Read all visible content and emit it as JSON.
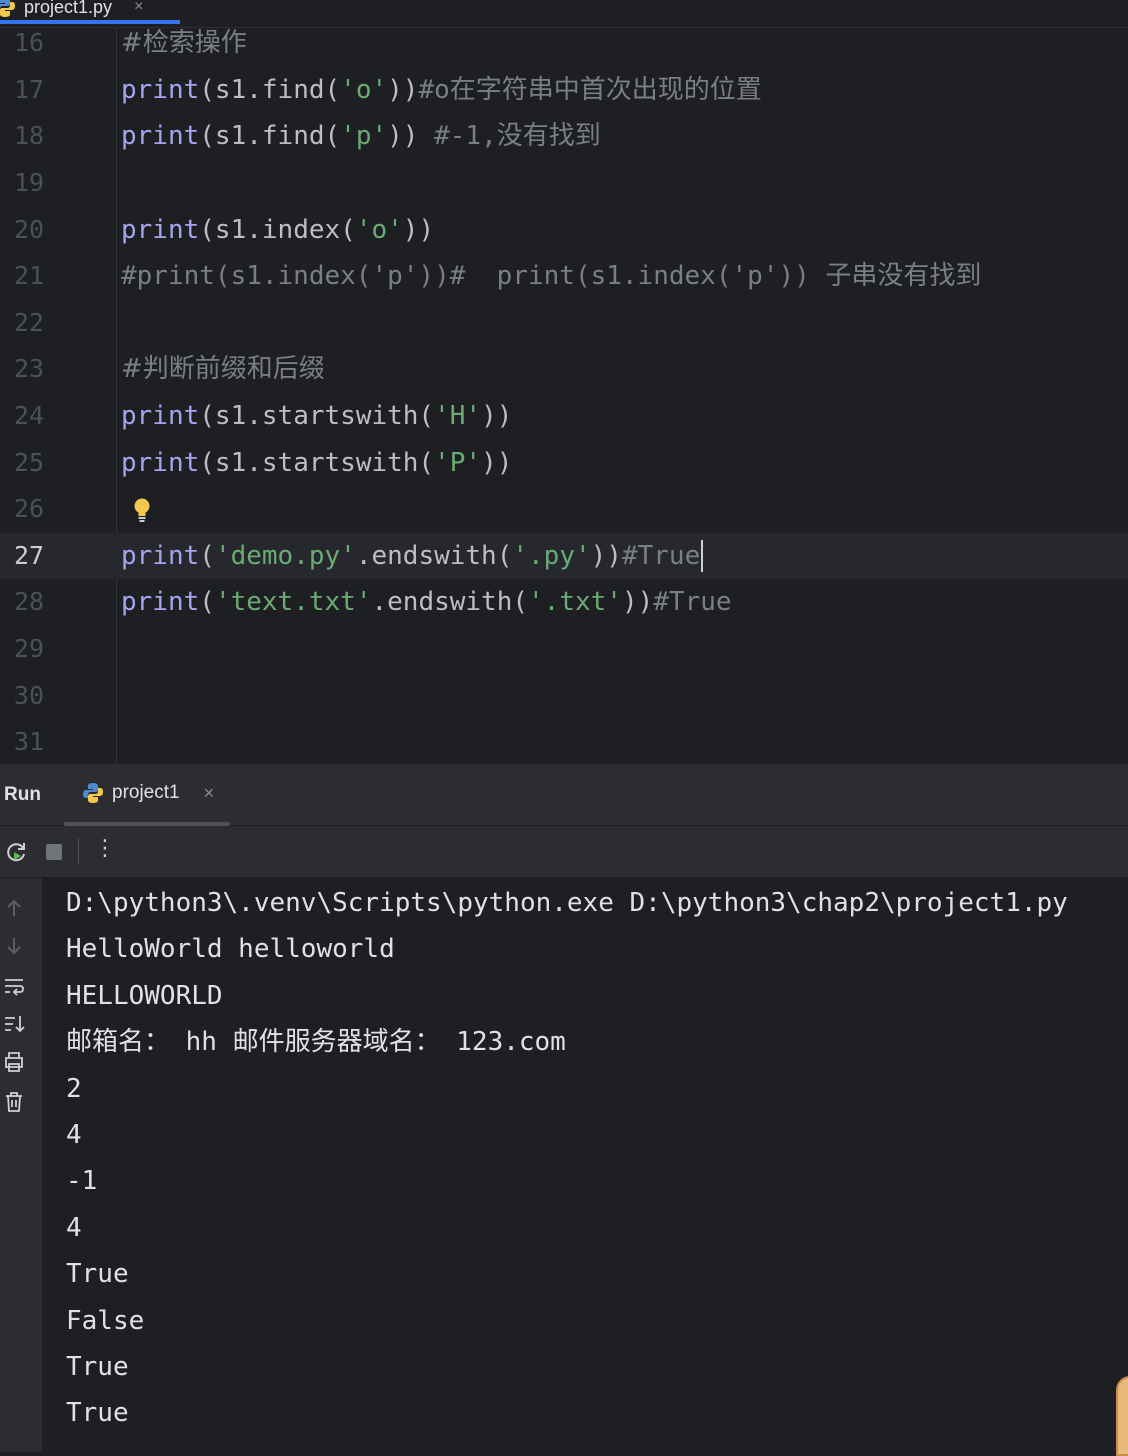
{
  "editor_tab": {
    "filename": "project1.py",
    "close": "×"
  },
  "code_lines": [
    {
      "num": "16",
      "parts": [
        {
          "t": "#检索操作",
          "c": "cmt cjk"
        }
      ]
    },
    {
      "num": "17",
      "parts": [
        {
          "t": "print",
          "c": "kw"
        },
        {
          "t": "(s1.find(",
          "c": "plain"
        },
        {
          "t": "'o'",
          "c": "str"
        },
        {
          "t": "))",
          "c": "plain"
        },
        {
          "t": "#o在字符串中首次出现的位置",
          "c": "cmt"
        }
      ]
    },
    {
      "num": "18",
      "parts": [
        {
          "t": "print",
          "c": "kw"
        },
        {
          "t": "(s1.find(",
          "c": "plain"
        },
        {
          "t": "'p'",
          "c": "str"
        },
        {
          "t": ")) ",
          "c": "plain"
        },
        {
          "t": "#-1,没有找到",
          "c": "cmt"
        }
      ]
    },
    {
      "num": "19",
      "parts": []
    },
    {
      "num": "20",
      "parts": [
        {
          "t": "print",
          "c": "kw"
        },
        {
          "t": "(s1.index(",
          "c": "plain"
        },
        {
          "t": "'o'",
          "c": "str"
        },
        {
          "t": "))",
          "c": "plain"
        }
      ]
    },
    {
      "num": "21",
      "parts": [
        {
          "t": "#print(s1.index('p'))#  print(s1.index('p')) 子串没有找到",
          "c": "cmt"
        }
      ]
    },
    {
      "num": "22",
      "parts": []
    },
    {
      "num": "23",
      "parts": [
        {
          "t": "#判断前缀和后缀",
          "c": "cmt cjk"
        }
      ]
    },
    {
      "num": "24",
      "parts": [
        {
          "t": "print",
          "c": "kw"
        },
        {
          "t": "(s1.startswith(",
          "c": "plain"
        },
        {
          "t": "'H'",
          "c": "str"
        },
        {
          "t": "))",
          "c": "plain"
        }
      ]
    },
    {
      "num": "25",
      "parts": [
        {
          "t": "print",
          "c": "kw"
        },
        {
          "t": "(s1.startswith(",
          "c": "plain"
        },
        {
          "t": "'P'",
          "c": "str"
        },
        {
          "t": "))",
          "c": "plain"
        }
      ]
    },
    {
      "num": "26",
      "parts": []
    },
    {
      "num": "27",
      "current": true,
      "parts": [
        {
          "t": "print",
          "c": "kw"
        },
        {
          "t": "(",
          "c": "plain"
        },
        {
          "t": "'demo.py'",
          "c": "str"
        },
        {
          "t": ".endswith(",
          "c": "plain"
        },
        {
          "t": "'.py'",
          "c": "str"
        },
        {
          "t": "))",
          "c": "plain"
        },
        {
          "t": "#True",
          "c": "cmt"
        }
      ]
    },
    {
      "num": "28",
      "parts": [
        {
          "t": "print",
          "c": "kw"
        },
        {
          "t": "(",
          "c": "plain"
        },
        {
          "t": "'text.txt'",
          "c": "str"
        },
        {
          "t": ".endswith(",
          "c": "plain"
        },
        {
          "t": "'.txt'",
          "c": "str"
        },
        {
          "t": "))",
          "c": "plain"
        },
        {
          "t": "#True",
          "c": "cmt"
        }
      ]
    },
    {
      "num": "29",
      "parts": []
    },
    {
      "num": "30",
      "parts": []
    },
    {
      "num": "31",
      "parts": []
    }
  ],
  "run_panel": {
    "label": "Run",
    "tab_name": "project1",
    "close": "×",
    "toolbar_more": "⋮"
  },
  "console_output": [
    "D:\\python3\\.venv\\Scripts\\python.exe D:\\python3\\chap2\\project1.py",
    "HelloWorld helloworld",
    "HELLOWORLD",
    "邮箱名： hh 邮件服务器域名： 123.com",
    "2",
    "4",
    "-1",
    "4",
    "True",
    "False",
    "True",
    "True"
  ],
  "colors": {
    "keyword": "#a9a2ee",
    "string": "#6aab73",
    "comment": "#7a7e85",
    "accent": "#3574f0"
  }
}
